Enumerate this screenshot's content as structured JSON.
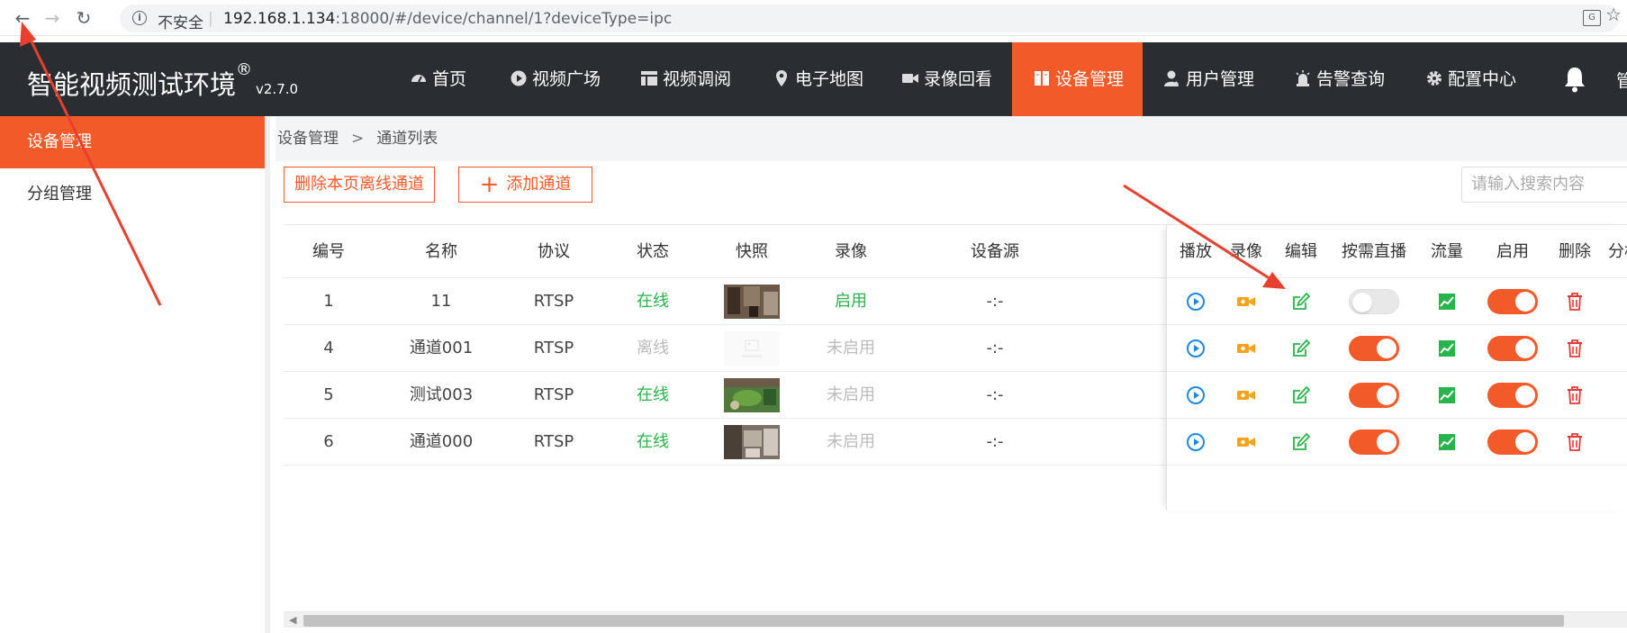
{
  "browser": {
    "insecure_label": "不安全",
    "url_host": "192.168.1.134",
    "url_rest": ":18000/#/device/channel/1?deviceType=ipc"
  },
  "app": {
    "brand": "智能视频测试环境",
    "brand_reg": "®",
    "version": "v2.7.0",
    "nav": [
      "首页",
      "视频广场",
      "视频调阅",
      "电子地图",
      "录像回看",
      "设备管理",
      "用户管理",
      "告警查询",
      "配置中心"
    ],
    "active_nav": "设备管理",
    "more": "管"
  },
  "sidebar": {
    "items": [
      "设备管理",
      "分组管理"
    ]
  },
  "breadcrumb": {
    "root": "设备管理",
    "sep": ">",
    "current": "通道列表"
  },
  "toolbar": {
    "delete_offline": "删除本页离线通道",
    "add_channel": "添加通道",
    "search_placeholder": "请输入搜索内容"
  },
  "table": {
    "headers": [
      "编号",
      "名称",
      "协议",
      "状态",
      "快照",
      "录像",
      "设备源",
      "播放",
      "录像",
      "编辑",
      "按需直播",
      "流量",
      "启用",
      "删除",
      "分析"
    ],
    "rows": [
      {
        "id": "1",
        "name": "11",
        "protocol": "RTSP",
        "status": "在线",
        "record": "启用",
        "source": "-:-",
        "on_demand": false,
        "enabled": true
      },
      {
        "id": "4",
        "name": "通道001",
        "protocol": "RTSP",
        "status": "离线",
        "record": "未启用",
        "source": "-:-",
        "on_demand": true,
        "enabled": true
      },
      {
        "id": "5",
        "name": "测试003",
        "protocol": "RTSP",
        "status": "在线",
        "record": "未启用",
        "source": "-:-",
        "on_demand": true,
        "enabled": true
      },
      {
        "id": "6",
        "name": "通道000",
        "protocol": "RTSP",
        "status": "在线",
        "record": "未启用",
        "source": "-:-",
        "on_demand": true,
        "enabled": true
      }
    ]
  },
  "colors": {
    "accent": "#f35a2a",
    "online": "#27b44a",
    "play": "#1e88e5",
    "record": "#f7a21b",
    "edit": "#27b44a",
    "delete": "#e53935",
    "annotation": "#e8402f"
  }
}
